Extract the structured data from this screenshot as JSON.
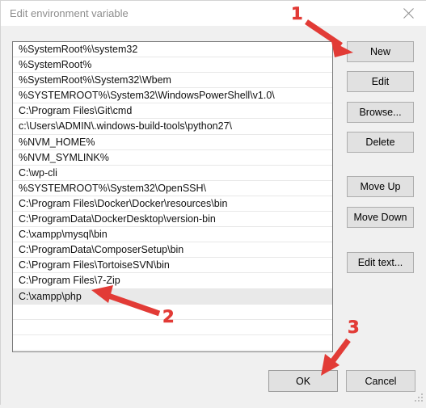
{
  "window": {
    "title": "Edit environment variable",
    "close_icon": "close-icon"
  },
  "list": {
    "items": [
      "%SystemRoot%\\system32",
      "%SystemRoot%",
      "%SystemRoot%\\System32\\Wbem",
      "%SYSTEMROOT%\\System32\\WindowsPowerShell\\v1.0\\",
      "C:\\Program Files\\Git\\cmd",
      "c:\\Users\\ADMIN\\.windows-build-tools\\python27\\",
      "%NVM_HOME%",
      "%NVM_SYMLINK%",
      "C:\\wp-cli",
      "%SYSTEMROOT%\\System32\\OpenSSH\\",
      "C:\\Program Files\\Docker\\Docker\\resources\\bin",
      "C:\\ProgramData\\DockerDesktop\\version-bin",
      "C:\\xampp\\mysql\\bin",
      "C:\\ProgramData\\ComposerSetup\\bin",
      "C:\\Program Files\\TortoiseSVN\\bin",
      "C:\\Program Files\\7-Zip",
      "C:\\xampp\\php"
    ],
    "selected_index": 16,
    "empty_rows": 3
  },
  "buttons": {
    "new": "New",
    "edit": "Edit",
    "browse": "Browse...",
    "delete": "Delete",
    "move_up": "Move Up",
    "move_down": "Move Down",
    "edit_text": "Edit text...",
    "ok": "OK",
    "cancel": "Cancel"
  },
  "annotations": {
    "accent_color": "#e23b36",
    "markers": [
      {
        "label": "1"
      },
      {
        "label": "2"
      },
      {
        "label": "3"
      }
    ]
  }
}
